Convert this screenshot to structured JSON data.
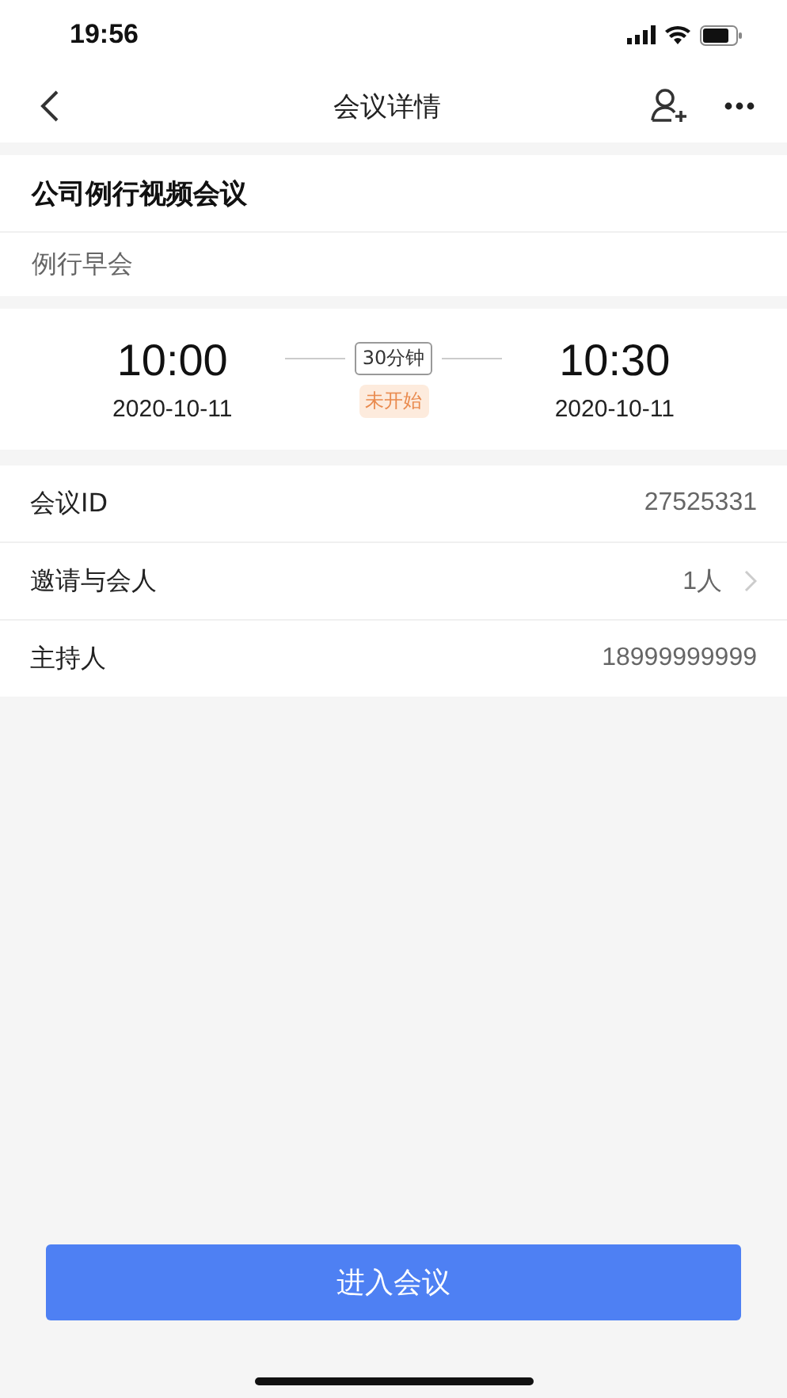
{
  "status_bar": {
    "time": "19:56"
  },
  "nav": {
    "title": "会议详情"
  },
  "meeting": {
    "name": "公司例行视频会议",
    "subject": "例行早会"
  },
  "schedule": {
    "start_time": "10:00",
    "start_date": "2020-10-11",
    "duration": "30分钟",
    "status": "未开始",
    "end_time": "10:30",
    "end_date": "2020-10-11"
  },
  "details": [
    {
      "label": "会议ID",
      "value": "27525331",
      "kind": "plain"
    },
    {
      "label": "邀请与会人",
      "value": "1人",
      "kind": "link"
    },
    {
      "label": "主持人",
      "value": "18999999999",
      "kind": "plain"
    }
  ],
  "join_button": "进入会议"
}
